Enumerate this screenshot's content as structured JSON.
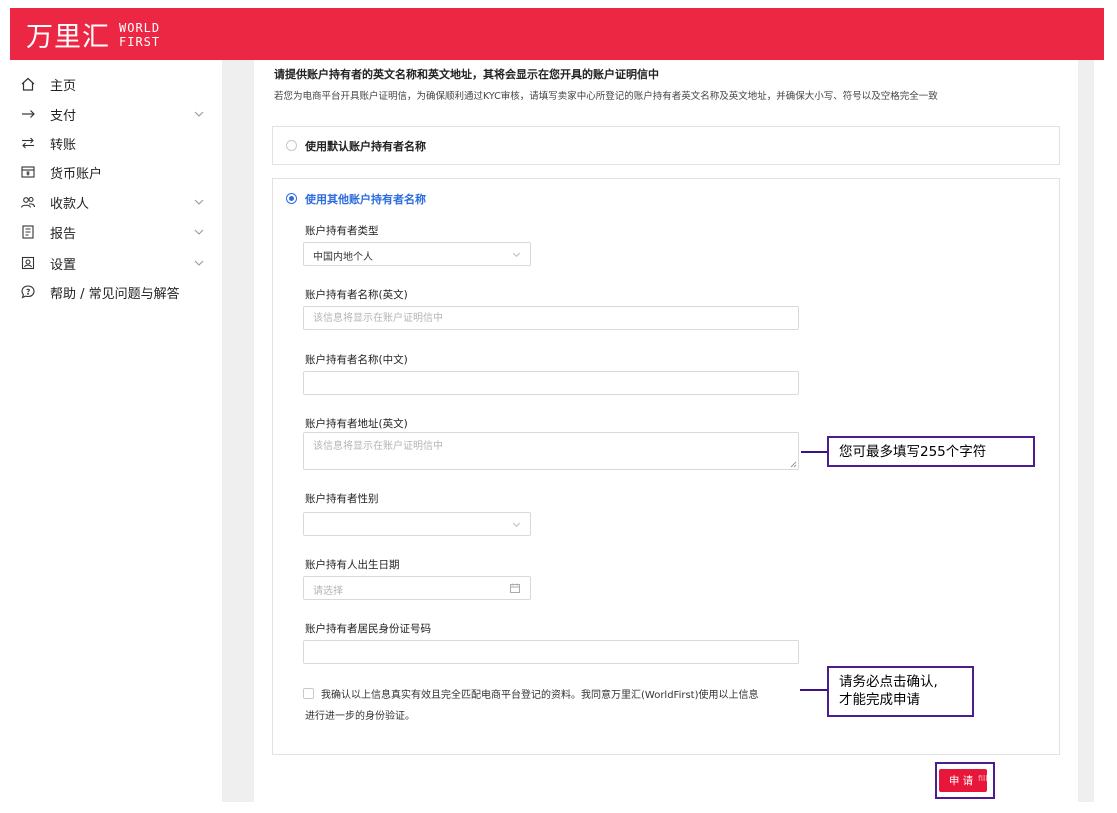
{
  "brand": {
    "name_cn": "万里汇",
    "name_en_line1": "WORLD",
    "name_en_line2": "FIRST",
    "color": "#eb2744"
  },
  "sidebar": {
    "items": [
      {
        "label": "主页",
        "icon": "home-icon",
        "has_children": false
      },
      {
        "label": "支付",
        "icon": "arrow-right-icon",
        "has_children": true
      },
      {
        "label": "转账",
        "icon": "transfer-icon",
        "has_children": false
      },
      {
        "label": "货币账户",
        "icon": "wallet-icon",
        "has_children": false
      },
      {
        "label": "收款人",
        "icon": "users-icon",
        "has_children": true
      },
      {
        "label": "报告",
        "icon": "report-icon",
        "has_children": true
      },
      {
        "label": "设置",
        "icon": "settings-icon",
        "has_children": true
      },
      {
        "label": "帮助 / 常见问题与解答",
        "icon": "help-chat-icon",
        "has_children": false
      }
    ]
  },
  "form": {
    "heading": "请提供账户持有者的英文名称和英文地址，其将会显示在您开具的账户证明信中",
    "subtext": "若您为电商平台开具账户证明信，为确保顺利通过KYC审核，请填写卖家中心所登记的账户持有者英文名称及英文地址，并确保大小写、符号以及空格完全一致",
    "option_default": {
      "label": "使用默认账户持有者名称",
      "selected": false
    },
    "option_other": {
      "label": "使用其他账户持有者名称",
      "selected": true
    },
    "fields": {
      "holder_type": {
        "label": "账户持有者类型",
        "value": "中国内地个人"
      },
      "name_en": {
        "label": "账户持有者名称(英文)",
        "placeholder": "该信息将显示在账户证明信中",
        "value": ""
      },
      "name_cn": {
        "label": "账户持有者名称(中文)",
        "placeholder": "",
        "value": ""
      },
      "address_en": {
        "label": "账户持有者地址(英文)",
        "placeholder": "该信息将显示在账户证明信中",
        "value": ""
      },
      "gender": {
        "label": "账户持有者性别",
        "value": ""
      },
      "birth_date": {
        "label": "账户持有人出生日期",
        "placeholder": "请选择"
      },
      "id_number": {
        "label": "账户持有者居民身份证号码",
        "placeholder": "",
        "value": ""
      }
    },
    "consent": {
      "line1": "我确认以上信息真实有效且完全匹配电商平台登记的资料。我同意万里汇(WorldFirst)使用以上信息",
      "line2": "进行进一步的身份验证。",
      "checked": false
    },
    "submit_label": "申 请",
    "submit_ghost": "fill"
  },
  "annotations": {
    "char_limit": "您可最多填写255个字符",
    "confirm_line1": "请务必点击确认,",
    "confirm_line2": "才能完成申请",
    "color": "#4b1e8f"
  },
  "colors": {
    "accent_red": "#eb2744",
    "button_red": "#e8163b",
    "radio_blue": "#2d6cdf",
    "content_bg": "#efefef"
  }
}
